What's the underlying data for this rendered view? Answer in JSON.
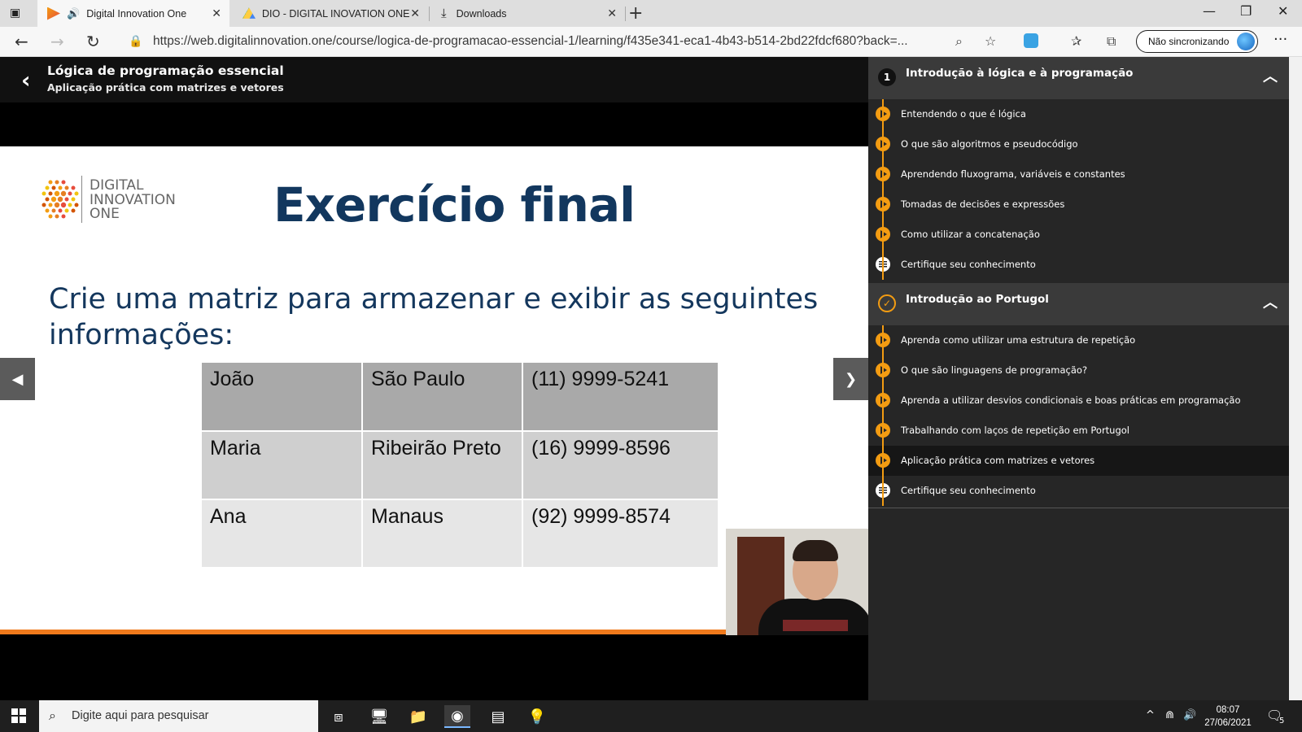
{
  "browser": {
    "tabs": [
      {
        "label": "Digital Innovation One",
        "active": true
      },
      {
        "label": "DIO - DIGITAL INOVATION ONE",
        "active": false
      },
      {
        "label": "Downloads",
        "active": false
      }
    ],
    "url": "https://web.digitalinnovation.one/course/logica-de-programacao-essencial-1/learning/f435e341-eca1-4b43-b514-2bd22fdcf680?back=...",
    "sync_label": "Não sincronizando"
  },
  "course": {
    "title": "Lógica de programação essencial",
    "subtitle": "Aplicação prática com matrizes e vetores"
  },
  "slide": {
    "logo_line1": "DIGITAL",
    "logo_line2": "INNOVATION",
    "logo_line3": "ONE",
    "title": "Exercício final",
    "text": "Crie uma matriz para armazenar e exibir as seguintes informações:",
    "table": [
      [
        "João",
        "São Paulo",
        "(11) 9999-5241"
      ],
      [
        "Maria",
        "Ribeirão Preto",
        "(16) 9999-8596"
      ],
      [
        "Ana",
        "Manaus",
        "(92) 9999-8574"
      ]
    ]
  },
  "sidebar": {
    "sections": [
      {
        "number": "1",
        "title": "Introdução à lógica e à programação",
        "lessons": [
          {
            "label": "Entendendo o que é lógica",
            "type": "video"
          },
          {
            "label": "O que são algoritmos e pseudocódigo",
            "type": "video"
          },
          {
            "label": "Aprendendo fluxograma, variáveis e constantes",
            "type": "video"
          },
          {
            "label": "Tomadas de decisões e expressões",
            "type": "video"
          },
          {
            "label": "Como utilizar a concatenação",
            "type": "video"
          },
          {
            "label": "Certifique seu conhecimento",
            "type": "quiz"
          }
        ]
      },
      {
        "title": "Introdução ao Portugol",
        "lessons": [
          {
            "label": "Aprenda como utilizar uma estrutura de repetição",
            "type": "video"
          },
          {
            "label": "O que são linguagens de programação?",
            "type": "video"
          },
          {
            "label": "Aprenda a utilizar desvios condicionais e boas práticas em programação",
            "type": "video"
          },
          {
            "label": "Trabalhando com laços de repetição em Portugol",
            "type": "video"
          },
          {
            "label": "Aplicação prática com matrizes e vetores",
            "type": "video",
            "current": true
          },
          {
            "label": "Certifique seu conhecimento",
            "type": "quiz"
          }
        ]
      }
    ]
  },
  "taskbar": {
    "search_placeholder": "Digite aqui para pesquisar",
    "time": "08:07",
    "date": "27/06/2021",
    "notification_count": "5"
  },
  "colors": {
    "accent_orange": "#f39c12",
    "slide_title_blue": "#12375e"
  }
}
